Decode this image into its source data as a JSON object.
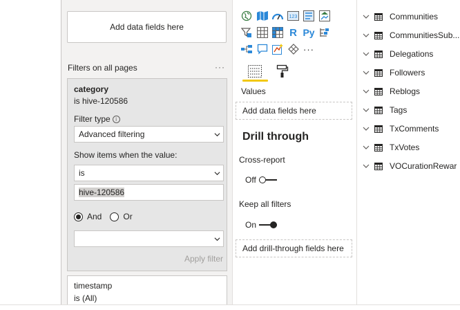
{
  "filters_pane": {
    "add_fields_label": "Add data fields here",
    "section_title": "Filters on all pages",
    "more_label": "···",
    "category_card": {
      "title": "category",
      "subtitle": "is hive-120586",
      "filter_type_label": "Filter type",
      "filter_type_value": "Advanced filtering",
      "show_items_label": "Show items when the value:",
      "condition_value": "is",
      "input_value": "hive-120586",
      "and_label": "And",
      "or_label": "Or",
      "selected_logic": "And",
      "second_condition_value": "",
      "apply_label": "Apply filter"
    },
    "timestamp_card": {
      "title": "timestamp",
      "subtitle": "is (All)"
    }
  },
  "viz_pane": {
    "icons": [
      "map-globe-icon",
      "filled-map-icon",
      "gauge-icon",
      "card-icon",
      "multi-row-card-icon",
      "kpi-icon",
      "slicer-icon",
      "table-icon",
      "matrix-icon",
      "r-visual-icon",
      "python-visual-icon",
      "key-influencers-icon",
      "decomposition-tree-icon",
      "qa-icon",
      "smart-narrative-icon",
      "paginated-report-icon",
      "more-visuals-icon"
    ],
    "r_label": "R",
    "py_label": "Py",
    "more_visuals_label": "···",
    "values_label": "Values",
    "values_placeholder": "Add data fields here",
    "drill_through_title": "Drill through",
    "cross_report_label": "Cross-report",
    "cross_report_state": "Off",
    "keep_filters_label": "Keep all filters",
    "keep_filters_state": "On",
    "drill_placeholder": "Add drill-through fields here",
    "accent_color": "#f2c811"
  },
  "fields_pane": {
    "tables": [
      "Communities",
      "CommunitiesSub...",
      "Delegations",
      "Followers",
      "Reblogs",
      "Tags",
      "TxComments",
      "TxVotes",
      "VOCurationRewar"
    ]
  }
}
